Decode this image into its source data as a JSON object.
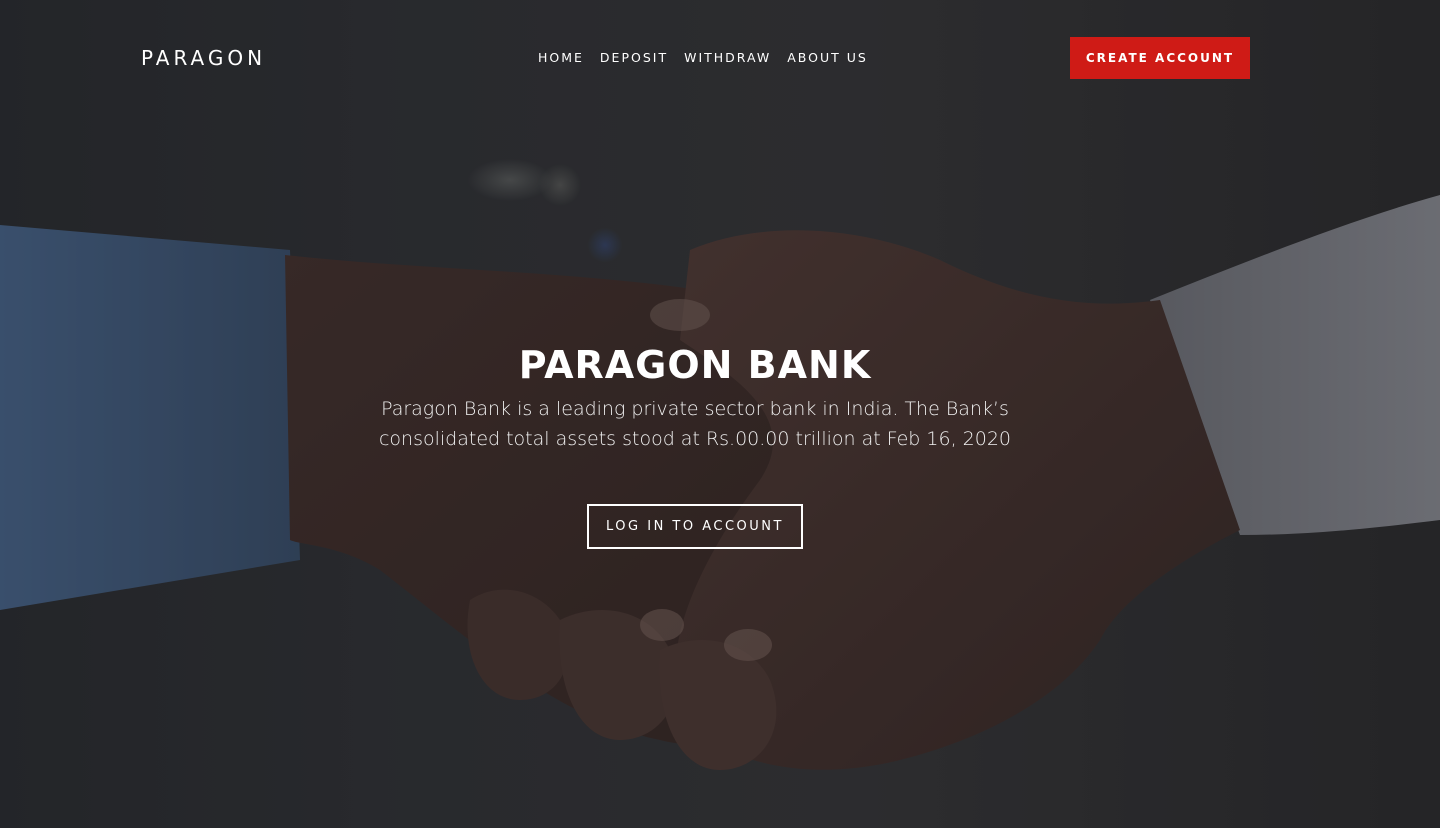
{
  "brand": {
    "name": "PARAGON"
  },
  "nav": {
    "items": [
      {
        "label": "HOME"
      },
      {
        "label": "DEPOSIT"
      },
      {
        "label": "WITHDRAW"
      },
      {
        "label": "ABOUT US"
      }
    ]
  },
  "header": {
    "cta_label": "CREATE ACCOUNT"
  },
  "hero": {
    "title": "PARAGON BANK",
    "description": "Paragon Bank is a leading private sector bank in India. The Bank’s consolidated total assets stood at Rs.00.00 trillion at Feb 16, 2020",
    "login_label": "LOG IN TO ACCOUNT",
    "background_subject": "handshake-photo"
  },
  "colors": {
    "accent": "#cf1b16",
    "text": "#ffffff",
    "overlay": "#1a1a1e"
  }
}
